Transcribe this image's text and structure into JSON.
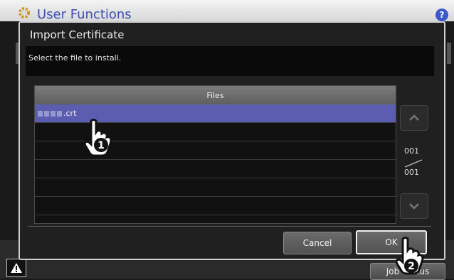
{
  "app": {
    "title": "User Functions",
    "help_label": "?"
  },
  "dialog": {
    "title": "Import Certificate",
    "message": "Select the file to install.",
    "files_header": "Files",
    "files": [
      {
        "name": ".crt",
        "selected": true
      },
      {
        "name": "",
        "selected": false
      },
      {
        "name": "",
        "selected": false
      },
      {
        "name": "",
        "selected": false
      },
      {
        "name": "",
        "selected": false
      },
      {
        "name": "",
        "selected": false
      }
    ],
    "page_current": "001",
    "page_total": "001",
    "cancel_label": "Cancel",
    "ok_label": "OK"
  },
  "bottom": {
    "job_status_label": "Job Status"
  },
  "annotations": {
    "step1": "1",
    "step2": "2"
  },
  "icons": [
    "gear-icon",
    "help-icon",
    "warning-icon",
    "scroll-up-icon",
    "scroll-down-icon",
    "hand-pointer-icon"
  ],
  "colors": {
    "selected_row": "#5b5db0",
    "title_blue": "#3a4fb0",
    "dialog_bg": "#202020"
  }
}
